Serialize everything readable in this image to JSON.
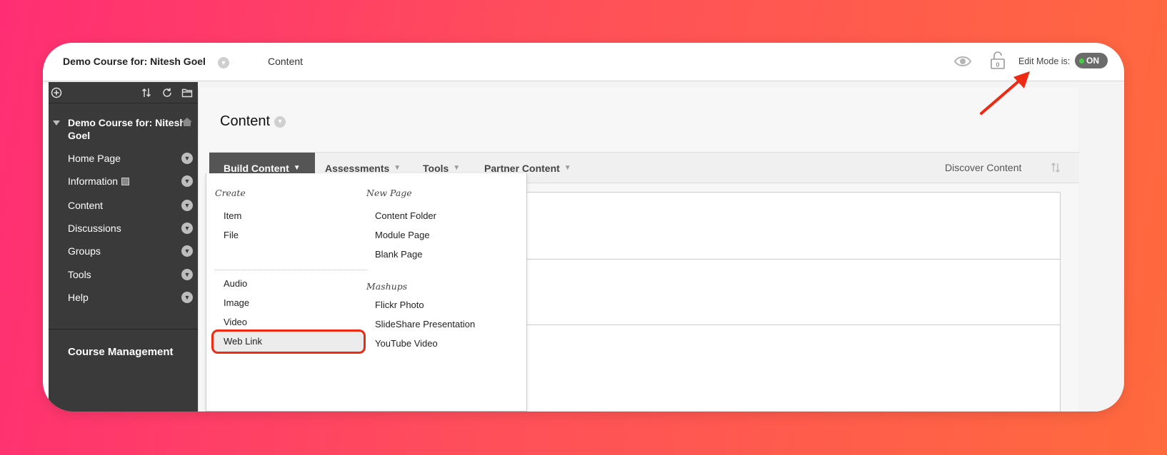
{
  "topbar": {
    "course_title": "Demo Course for: Nitesh Goel",
    "breadcrumb": "Content",
    "edit_mode_label": "Edit Mode is:",
    "edit_mode_state": "ON",
    "lock_count": "0"
  },
  "sidebar": {
    "course_name": "Demo Course for: Nitesh Goel",
    "items": [
      {
        "label": "Home Page"
      },
      {
        "label": "Information"
      },
      {
        "label": "Content"
      },
      {
        "label": "Discussions"
      },
      {
        "label": "Groups"
      },
      {
        "label": "Tools"
      },
      {
        "label": "Help"
      }
    ],
    "course_management": "Course Management"
  },
  "main": {
    "page_title": "Content",
    "action_bar": {
      "build_content": "Build Content",
      "assessments": "Assessments",
      "tools": "Tools",
      "partner_content": "Partner Content",
      "discover_content": "Discover Content"
    }
  },
  "build_menu": {
    "create_heading": "Create",
    "create_items": [
      "Item",
      "File"
    ],
    "media_items": [
      "Audio",
      "Image",
      "Video",
      "Web Link"
    ],
    "new_page_heading": "New Page",
    "new_page_items": [
      "Content Folder",
      "Module Page",
      "Blank Page"
    ],
    "mashups_heading": "Mashups",
    "mashups_items": [
      "Flickr Photo",
      "SlideShare Presentation",
      "YouTube Video"
    ]
  },
  "colors": {
    "highlight": "#ee2a12",
    "sidebar_bg": "#3a3a3a",
    "toggle_on": "#3fd43f"
  },
  "icons": [
    "add-icon",
    "sort-icon",
    "refresh-icon",
    "folder-icon",
    "home-icon",
    "eye-icon",
    "lock-icon",
    "chevron-down-icon",
    "reorder-icon",
    "arrow-icon"
  ]
}
